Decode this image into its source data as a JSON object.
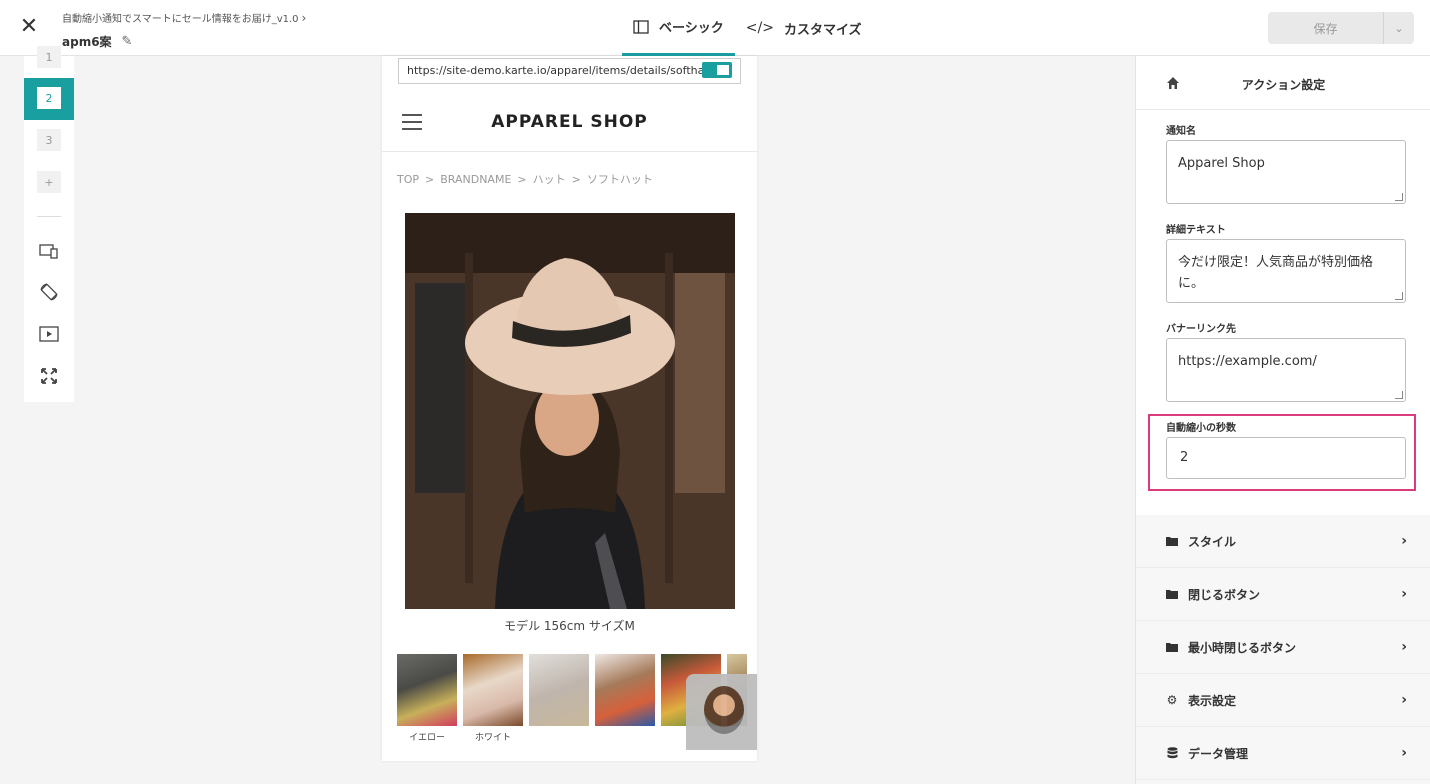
{
  "header": {
    "campaign_title": "自動縮小通知でスマートにセール情報をお届け_v1.0",
    "variant_name": "apm6案",
    "tabs": [
      {
        "label": "ベーシック",
        "icon": "layout-icon",
        "active": true
      },
      {
        "label": "カスタマイズ",
        "icon": "code-icon",
        "active": false
      }
    ],
    "save_label": "保存",
    "accent_color": "#1a9fa0"
  },
  "toolbar": {
    "steps": [
      "1",
      "2",
      "3"
    ],
    "active_step": "2",
    "add_label": "+",
    "icons": [
      "device-toggle-icon",
      "rotate-icon",
      "play-icon",
      "expand-icon"
    ]
  },
  "preview": {
    "url": "https://site-demo.karte.io/apparel/items/details/softhat",
    "shop_title": "APPAREL SHOP",
    "breadcrumb": [
      "TOP",
      "BRANDNAME",
      "ハット",
      "ソフトハット"
    ],
    "breadcrumb_sep": ">",
    "caption": "モデル 156cm サイズM",
    "thumbnails": [
      {
        "label": "イエロー"
      },
      {
        "label": "ホワイト"
      },
      {
        "label": ""
      },
      {
        "label": ""
      },
      {
        "label": ""
      },
      {
        "label": ""
      }
    ]
  },
  "panel": {
    "title": "アクション設定",
    "fields": [
      {
        "label": "通知名",
        "value": "Apparel Shop"
      },
      {
        "label": "詳細テキスト",
        "value": "今だけ限定！人気商品が特別価格に。"
      },
      {
        "label": "バナーリンク先",
        "value": "https://example.com/"
      }
    ],
    "auto_shrink": {
      "label": "自動縮小の秒数",
      "value": "2"
    },
    "highlight_color": "#d93b7d",
    "sections": [
      {
        "label": "スタイル",
        "icon": "folder-icon"
      },
      {
        "label": "閉じるボタン",
        "icon": "folder-icon"
      },
      {
        "label": "最小時閉じるボタン",
        "icon": "folder-icon"
      },
      {
        "label": "表示設定",
        "icon": "gear-icon"
      },
      {
        "label": "データ管理",
        "icon": "database-icon"
      }
    ]
  }
}
